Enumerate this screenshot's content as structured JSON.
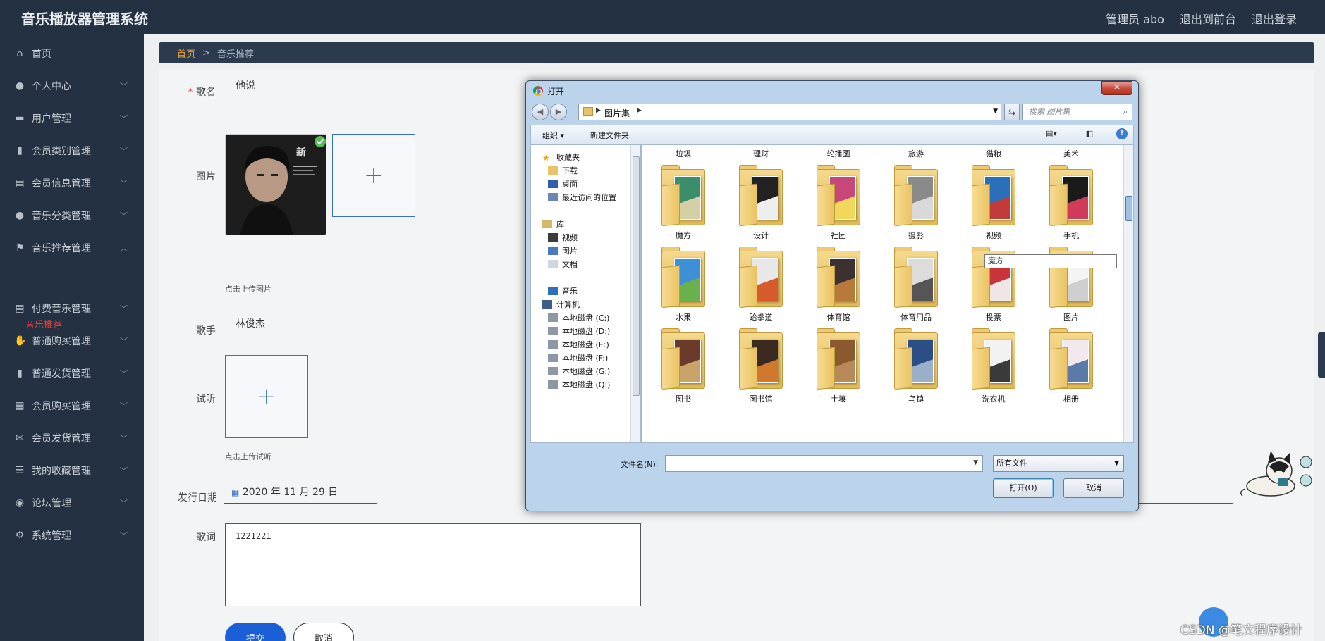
{
  "app": {
    "title": "音乐播放器管理系统",
    "user_label": "管理员 abo",
    "to_front_label": "退出到前台",
    "logout_label": "退出登录"
  },
  "sidebar": {
    "items": [
      {
        "label": "首页",
        "icon": "home-icon",
        "expandable": false
      },
      {
        "label": "个人中心",
        "icon": "user-icon",
        "expandable": true
      },
      {
        "label": "用户管理",
        "icon": "briefcase-icon",
        "expandable": true
      },
      {
        "label": "会员类别管理",
        "icon": "bar-chart-icon",
        "expandable": true
      },
      {
        "label": "会员信息管理",
        "icon": "clipboard-icon",
        "expandable": true
      },
      {
        "label": "音乐分类管理",
        "icon": "user-icon",
        "expandable": true
      },
      {
        "label": "音乐推荐管理",
        "icon": "flag-icon",
        "expandable": true,
        "expanded": true
      },
      {
        "label": "付费音乐管理",
        "icon": "clipboard-icon",
        "expandable": true
      },
      {
        "label": "普通购买管理",
        "icon": "thumbs-up-icon",
        "expandable": true
      },
      {
        "label": "普通发货管理",
        "icon": "bar-chart-icon",
        "expandable": true
      },
      {
        "label": "会员购买管理",
        "icon": "grid-icon",
        "expandable": true
      },
      {
        "label": "会员发货管理",
        "icon": "mail-icon",
        "expandable": true
      },
      {
        "label": "我的收藏管理",
        "icon": "sliders-icon",
        "expandable": true
      },
      {
        "label": "论坛管理",
        "icon": "map-pin-icon",
        "expandable": true
      },
      {
        "label": "系统管理",
        "icon": "gear-icon",
        "expandable": true
      }
    ],
    "active_sub": "音乐推荐"
  },
  "breadcrumb": {
    "home": "首页",
    "separator": ">",
    "current": "音乐推荐"
  },
  "form": {
    "song_label": "歌名",
    "song_value": "他说",
    "image_label": "图片",
    "image_hint": "点击上传图片",
    "singer_label": "歌手",
    "singer_value": "林俊杰",
    "audition_label": "试听",
    "audition_hint": "点击上传试听",
    "date_label": "发行日期",
    "date_value": "2020 年 11 月 29 日",
    "lyrics_label": "歌词",
    "lyrics_value": "1221221",
    "submit_label": "提交",
    "cancel_label": "取消"
  },
  "dialog": {
    "title": "打开",
    "close_glyph": "✕",
    "address_crumb": "图片集",
    "search_placeholder": "搜索 图片集",
    "organize_label": "组织",
    "new_folder_label": "新建文件夹",
    "nav_items": [
      {
        "label": "收藏夹",
        "icon": "star-icon",
        "indent": 0
      },
      {
        "label": "下载",
        "icon": "download-folder-icon",
        "indent": 1
      },
      {
        "label": "桌面",
        "icon": "desktop-icon",
        "indent": 1
      },
      {
        "label": "最近访问的位置",
        "icon": "recent-places-icon",
        "indent": 1
      },
      {
        "label": "库",
        "icon": "library-icon",
        "indent": 0
      },
      {
        "label": "视频",
        "icon": "video-library-icon",
        "indent": 1
      },
      {
        "label": "图片",
        "icon": "pictures-library-icon",
        "indent": 1
      },
      {
        "label": "文档",
        "icon": "documents-library-icon",
        "indent": 1
      },
      {
        "label": "音乐",
        "icon": "music-library-icon",
        "indent": 1
      },
      {
        "label": "计算机",
        "icon": "computer-icon",
        "indent": 0
      },
      {
        "label": "本地磁盘 (C:)",
        "icon": "drive-icon",
        "indent": 1
      },
      {
        "label": "本地磁盘 (D:)",
        "icon": "drive-icon",
        "indent": 1
      },
      {
        "label": "本地磁盘 (E:)",
        "icon": "drive-icon",
        "indent": 1
      },
      {
        "label": "本地磁盘 (F:)",
        "icon": "drive-icon",
        "indent": 1
      },
      {
        "label": "本地磁盘 (G:)",
        "icon": "drive-icon",
        "indent": 1
      },
      {
        "label": "本地磁盘 (Q:)",
        "icon": "drive-icon",
        "indent": 1
      }
    ],
    "top_row_labels": [
      "垃圾",
      "理财",
      "轮播图",
      "旅游",
      "猫粮",
      "美术"
    ],
    "folders": [
      {
        "name": "魔方",
        "colors": [
          "#3a8f6a",
          "#d4cfa4"
        ]
      },
      {
        "name": "设计",
        "colors": [
          "#222222",
          "#eeeeee"
        ]
      },
      {
        "name": "社团",
        "colors": [
          "#c8477a",
          "#f2d85a"
        ]
      },
      {
        "name": "摄影",
        "colors": [
          "#8a8a8a",
          "#d9d9d9"
        ]
      },
      {
        "name": "视频",
        "colors": [
          "#2a6fb8",
          "#c23b3b"
        ]
      },
      {
        "name": "手机",
        "colors": [
          "#1a1a1a",
          "#d23a5a"
        ]
      },
      {
        "name": "水果",
        "colors": [
          "#3d8fd6",
          "#6ab04c"
        ]
      },
      {
        "name": "跆拳道",
        "colors": [
          "#e8e8e8",
          "#d55b2c"
        ]
      },
      {
        "name": "体育馆",
        "colors": [
          "#3c3030",
          "#b87a3a"
        ]
      },
      {
        "name": "体育用品",
        "colors": [
          "#dcdcdc",
          "#555555"
        ]
      },
      {
        "name": "投票",
        "colors": [
          "#c8343a",
          "#f0e6e6"
        ]
      },
      {
        "name": "图片",
        "colors": [
          "#f4f4f4",
          "#cfcfcf"
        ]
      },
      {
        "name": "图书",
        "colors": [
          "#6b3a2a",
          "#c9a46a"
        ]
      },
      {
        "name": "图书馆",
        "colors": [
          "#3a2a20",
          "#d0782e"
        ]
      },
      {
        "name": "土壤",
        "colors": [
          "#8a5a2e",
          "#b88a5a"
        ]
      },
      {
        "name": "乌镇",
        "colors": [
          "#2c4e86",
          "#9ab0c8"
        ]
      },
      {
        "name": "洗衣机",
        "colors": [
          "#f2f2f2",
          "#3a3a3a"
        ]
      },
      {
        "name": "相册",
        "colors": [
          "#f3e8ee",
          "#5a7aa8"
        ]
      }
    ],
    "tooltip": "魔方",
    "filename_label": "文件名(N):",
    "filename_value": "",
    "filetype_value": "所有文件",
    "open_label": "打开(O)",
    "cancel_label": "取消"
  },
  "watermark": "CSDN @笔文程序设计"
}
